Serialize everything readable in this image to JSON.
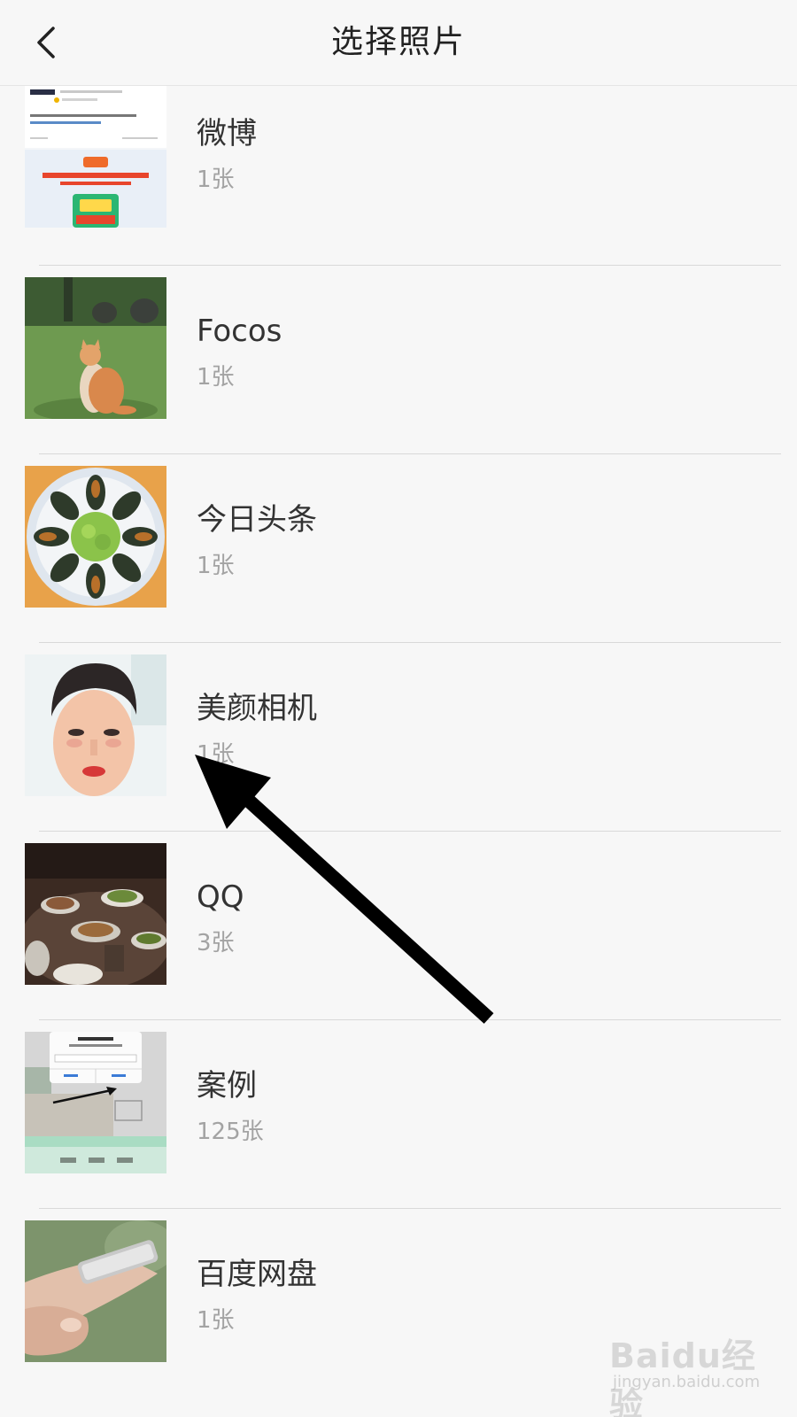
{
  "header": {
    "title": "选择照片",
    "back_icon": "chevron-left-icon"
  },
  "albums": [
    {
      "name": "微博",
      "count": "1张",
      "thumb": "weibo-screenshot"
    },
    {
      "name": "Focos",
      "count": "1张",
      "thumb": "cat-on-grass"
    },
    {
      "name": "今日头条",
      "count": "1张",
      "thumb": "preserved-egg-dish"
    },
    {
      "name": "美颜相机",
      "count": "1张",
      "thumb": "selfie-portrait"
    },
    {
      "name": "QQ",
      "count": "3张",
      "thumb": "dinner-table"
    },
    {
      "name": "案例",
      "count": "125张",
      "thumb": "dialog-screenshot"
    },
    {
      "name": "百度网盘",
      "count": "1张",
      "thumb": "hand-holding-phone"
    }
  ],
  "annotation": {
    "type": "arrow",
    "color": "#000000",
    "points_to": "美颜相机"
  },
  "watermark": {
    "logo": "Baidu经验",
    "url": "jingyan.baidu.com"
  },
  "colors": {
    "background": "#f7f7f7",
    "title_text": "#222222",
    "name_text": "#333333",
    "count_text": "#a3a3a3",
    "separator": "#d9d9d9"
  }
}
